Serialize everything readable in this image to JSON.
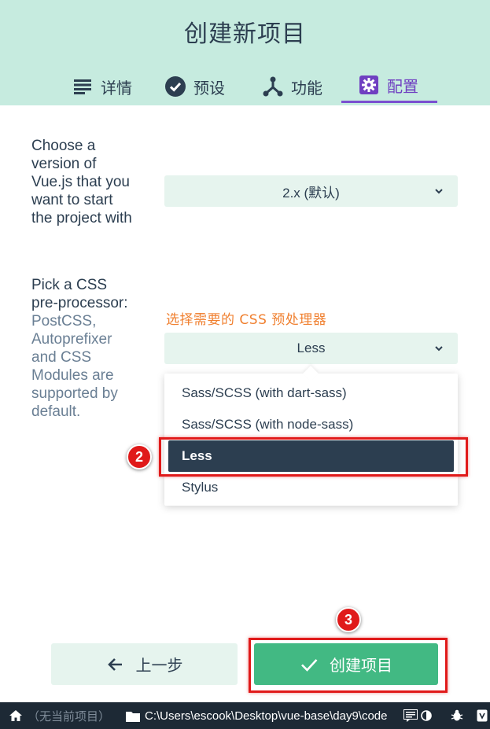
{
  "header": {
    "title": "创建新项目",
    "tabs": [
      {
        "label": "详情",
        "icon": "list-icon"
      },
      {
        "label": "预设",
        "icon": "check-circle-icon"
      },
      {
        "label": "功能",
        "icon": "fork-icon"
      },
      {
        "label": "配置",
        "icon": "settings-icon",
        "active": true
      }
    ]
  },
  "vue_version": {
    "label": "Choose a version of Vue.js that you want to start the project with",
    "selected": "2.x (默认)"
  },
  "css_preprocessor": {
    "label": "Pick a CSS pre-processor:",
    "description": "PostCSS, Autoprefixer and CSS Modules are supported by default.",
    "hint": "选择需要的 CSS 预处理器",
    "selected": "Less",
    "options": [
      "Sass/SCSS (with dart-sass)",
      "Sass/SCSS (with node-sass)",
      "Less",
      "Stylus"
    ]
  },
  "annotations": {
    "step2": "2",
    "step3": "3",
    "highlight_color": "#e01a1a"
  },
  "buttons": {
    "prev": "上一步",
    "create": "创建项目"
  },
  "statusbar": {
    "no_project": "（无当前项目）",
    "path": "C:\\Users\\escook\\Desktop\\vue-base\\day9\\code"
  },
  "colors": {
    "header_bg": "#c6ebdf",
    "accent_purple": "#7a4fd0",
    "primary_green": "#42b983",
    "dark": "#2c3e50",
    "hint_orange": "#f08030"
  }
}
